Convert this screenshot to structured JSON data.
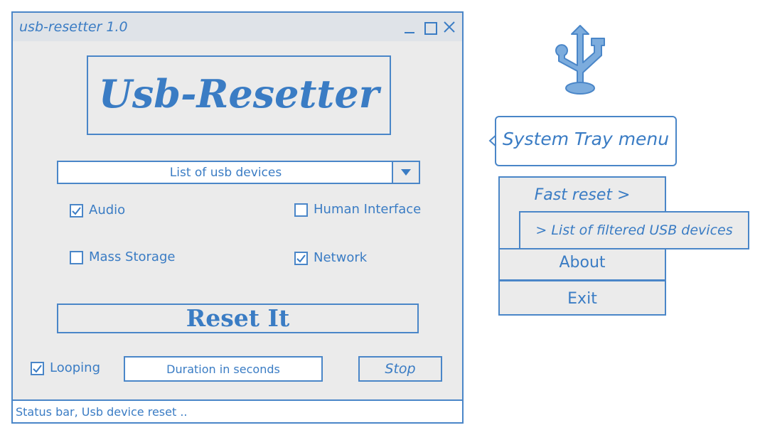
{
  "window": {
    "title": "usb-resetter 1.0",
    "controls": [
      "minimize-icon",
      "maximize-icon",
      "close-icon"
    ]
  },
  "logo": {
    "text": "Usb-Resetter"
  },
  "device_select": {
    "selected": "List of usb devices"
  },
  "filters": [
    {
      "label": "Audio",
      "checked": true
    },
    {
      "label": "Human Interface",
      "checked": false
    },
    {
      "label": "Mass Storage",
      "checked": false
    },
    {
      "label": "Network",
      "checked": true
    }
  ],
  "reset_button": {
    "label": "Reset It"
  },
  "looping": {
    "label": "Looping",
    "checked": true
  },
  "duration_input": {
    "placeholder": "Duration in seconds"
  },
  "stop_button": {
    "label": "Stop"
  },
  "status_bar": {
    "text": "Status bar, Usb device reset .."
  },
  "tray": {
    "icon": "usb-icon",
    "callout": "System Tray menu",
    "menu": {
      "fast_reset": "Fast reset >",
      "submenu_item": "> List of filtered USB devices",
      "about": "About",
      "exit": "Exit"
    }
  },
  "colors": {
    "accent": "#3a7cc4",
    "border": "#4a86c8",
    "background": "#ebebeb",
    "titlebar": "#dfe3e8",
    "icon_fill": "#7cacdd"
  }
}
